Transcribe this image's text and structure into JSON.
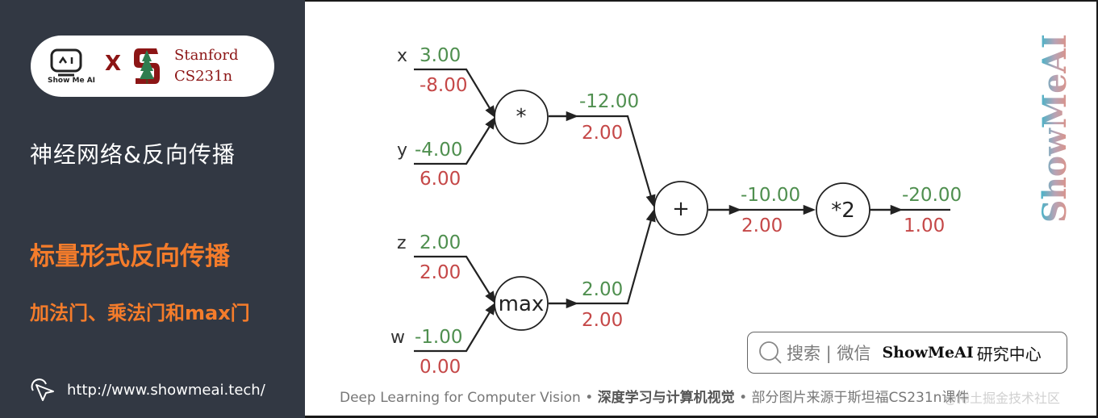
{
  "sidebar": {
    "logo": {
      "showme_label": "Show Me AI",
      "x_mark": "X",
      "stanford_line1": "Stanford",
      "stanford_line2": "CS231n",
      "brand_color": "#8c1515"
    },
    "subject": "神经网络&反向传播",
    "lesson_title": "标量形式反向传播",
    "lesson_subtitle": "加法门、乘法门和max门",
    "link": "http://www.showmeai.tech/",
    "accent_color": "#f47c2b"
  },
  "diagram": {
    "forward_color": "#4f8f4f",
    "backward_color": "#c54848",
    "inputs": [
      {
        "name": "x",
        "value": "3.00",
        "grad": "-8.00"
      },
      {
        "name": "y",
        "value": "-4.00",
        "grad": "6.00"
      },
      {
        "name": "z",
        "value": "2.00",
        "grad": "2.00"
      },
      {
        "name": "w",
        "value": "-1.00",
        "grad": "0.00"
      }
    ],
    "gates": [
      {
        "id": "mul",
        "label": "*",
        "out_value": "-12.00",
        "out_grad": "2.00"
      },
      {
        "id": "max",
        "label": "max",
        "out_value": "2.00",
        "out_grad": "2.00"
      },
      {
        "id": "add",
        "label": "+",
        "out_value": "-10.00",
        "out_grad": "2.00"
      },
      {
        "id": "scale",
        "label": "*2",
        "out_value": "-20.00",
        "out_grad": "1.00"
      }
    ]
  },
  "search_box": {
    "hint": "搜索 | 微信",
    "brand": "ShowMeAI",
    "suffix": "研究中心"
  },
  "footer": {
    "part1": "Deep Learning for Computer Vision",
    "sep": " • ",
    "part2": "深度学习与计算机视觉",
    "part3": "部分图片来源于斯坦福CS231n课件"
  },
  "watermark": {
    "vertical": "ShowMeAI",
    "overlay": "@稀土掘金技术社区"
  }
}
